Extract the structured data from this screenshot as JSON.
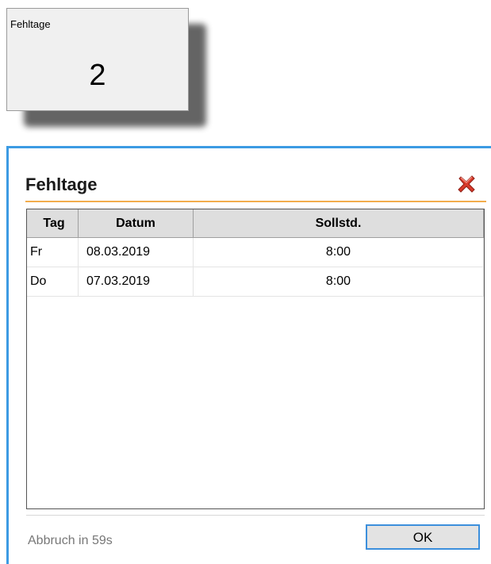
{
  "tile": {
    "title": "Fehltage",
    "value": "2"
  },
  "dialog": {
    "title": "Fehltage",
    "close_icon": "close-x-icon",
    "accent_color": "#f2ad4c",
    "border_color": "#3c9be3",
    "table": {
      "headers": [
        "Tag",
        "Datum",
        "Sollstd."
      ],
      "rows": [
        [
          "Fr",
          "08.03.2019",
          "8:00"
        ],
        [
          "Do",
          "07.03.2019",
          "8:00"
        ]
      ]
    },
    "footer": {
      "status": "Abbruch in 59s",
      "ok_label": "OK"
    }
  }
}
